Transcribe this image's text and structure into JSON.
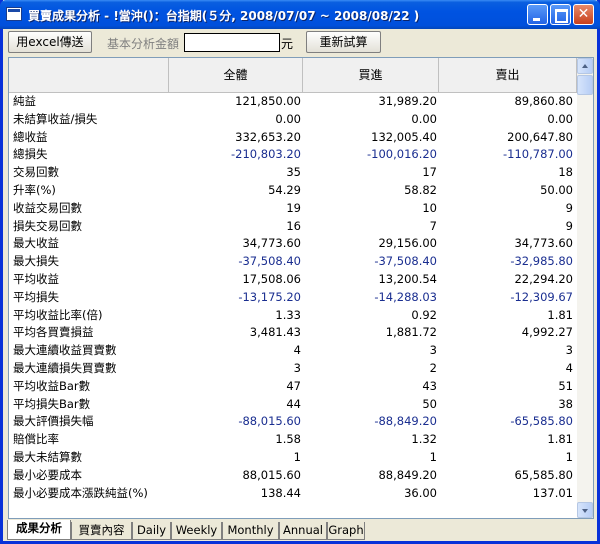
{
  "window": {
    "title": "買賣成果分析 - !當沖(",
    "title_suffix": ")：台指期(５分, 2008/07/07 ~ 2008/08/22 )"
  },
  "toolbar": {
    "excel_label": "用excel傳送",
    "amount_label": "基本分析金額",
    "amount_value": "",
    "unit_label": "元",
    "retry_label": "重新試算"
  },
  "table": {
    "headers": [
      "全體",
      "買進",
      "賣出"
    ],
    "rows": [
      {
        "label": "純益",
        "all": "121,850.00",
        "buy": "31,989.20",
        "sell": "89,860.80"
      },
      {
        "label": "未結算收益/損失",
        "all": "0.00",
        "buy": "0.00",
        "sell": "0.00"
      },
      {
        "label": "總收益",
        "all": "332,653.20",
        "buy": "132,005.40",
        "sell": "200,647.80"
      },
      {
        "label": "總損失",
        "all": "-210,803.20",
        "buy": "-100,016.20",
        "sell": "-110,787.00"
      },
      {
        "label": "交易回數",
        "all": "35",
        "buy": "17",
        "sell": "18"
      },
      {
        "label": "升率(%)",
        "all": "54.29",
        "buy": "58.82",
        "sell": "50.00"
      },
      {
        "label": "收益交易回數",
        "all": "19",
        "buy": "10",
        "sell": "9"
      },
      {
        "label": "損失交易回數",
        "all": "16",
        "buy": "7",
        "sell": "9"
      },
      {
        "label": "最大收益",
        "all": "34,773.60",
        "buy": "29,156.00",
        "sell": "34,773.60"
      },
      {
        "label": "最大損失",
        "all": "-37,508.40",
        "buy": "-37,508.40",
        "sell": "-32,985.80"
      },
      {
        "label": "平均收益",
        "all": "17,508.06",
        "buy": "13,200.54",
        "sell": "22,294.20"
      },
      {
        "label": "平均損失",
        "all": "-13,175.20",
        "buy": "-14,288.03",
        "sell": "-12,309.67"
      },
      {
        "label": "平均收益比率(倍)",
        "all": "1.33",
        "buy": "0.92",
        "sell": "1.81"
      },
      {
        "label": "平均各買賣損益",
        "all": "3,481.43",
        "buy": "1,881.72",
        "sell": "4,992.27"
      },
      {
        "label": "最大連續收益買賣數",
        "all": "4",
        "buy": "3",
        "sell": "3"
      },
      {
        "label": "最大連續損失買賣數",
        "all": "3",
        "buy": "2",
        "sell": "4"
      },
      {
        "label": "平均收益Bar數",
        "all": "47",
        "buy": "43",
        "sell": "51"
      },
      {
        "label": "平均損失Bar數",
        "all": "44",
        "buy": "50",
        "sell": "38"
      },
      {
        "label": "最大評價損失幅",
        "all": "-88,015.60",
        "buy": "-88,849.20",
        "sell": "-65,585.80"
      },
      {
        "label": "賠償比率",
        "all": "1.58",
        "buy": "1.32",
        "sell": "1.81"
      },
      {
        "label": "最大未結算數",
        "all": "1",
        "buy": "1",
        "sell": "1"
      },
      {
        "label": "最小必要成本",
        "all": "88,015.60",
        "buy": "88,849.20",
        "sell": "65,585.80"
      },
      {
        "label": "最小必要成本漲跌純益(%)",
        "all": "138.44",
        "buy": "36.00",
        "sell": "137.01"
      }
    ]
  },
  "tabs": [
    "成果分析",
    "買賣內容",
    "Daily",
    "Weekly",
    "Monthly",
    "Annual",
    "Graph"
  ],
  "colors": {
    "negative": "#1a2e90",
    "titlebar": "#0053e1"
  }
}
